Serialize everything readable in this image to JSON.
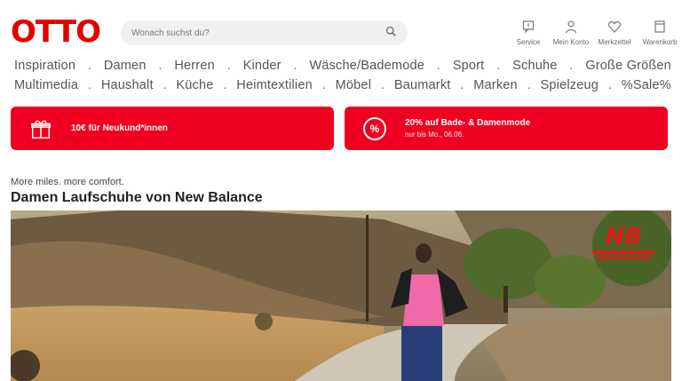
{
  "header": {
    "logo": "OTTO",
    "search_placeholder": "Wonach suchst du?",
    "icons": [
      {
        "label": "Service",
        "icon": "chat-icon"
      },
      {
        "label": "Mein Konto",
        "icon": "user-icon"
      },
      {
        "label": "Merkzettel",
        "icon": "heart-icon"
      },
      {
        "label": "Warenkorb",
        "icon": "cart-icon"
      }
    ]
  },
  "nav": {
    "row1": [
      "Inspiration",
      "Damen",
      "Herren",
      "Kinder",
      "Wäsche/Bademode",
      "Sport",
      "Schuhe",
      "Große Größen"
    ],
    "row2": [
      "Multimedia",
      "Haushalt",
      "Küche",
      "Heimtextilien",
      "Möbel",
      "Baumarkt",
      "Marken",
      "Spielzeug",
      "%Sale%"
    ],
    "separator": "."
  },
  "promos": [
    {
      "text": "10€ für Neukund*innen",
      "icon": "gift-icon"
    },
    {
      "text": "20% auf Bade- & Damenmode",
      "sub": "nur bis Mo., 06.06.",
      "icon": "percent-icon",
      "icon_text": "%"
    }
  ],
  "teaser": {
    "kicker": "More miles. more comfort.",
    "headline": "Damen Laufschuhe von New Balance"
  },
  "colors": {
    "brand": "#e20000",
    "promo": "#f00020"
  }
}
